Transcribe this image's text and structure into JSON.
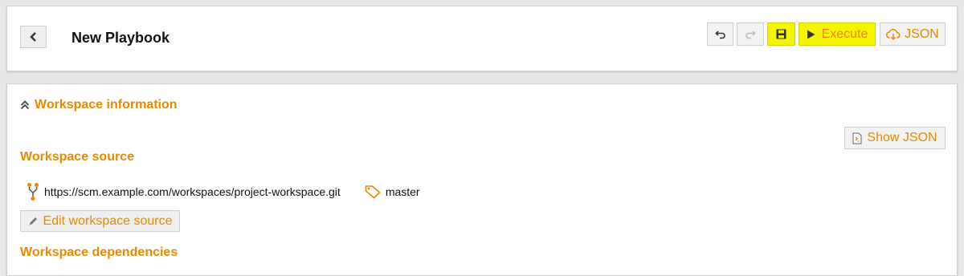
{
  "header": {
    "title": "New Playbook",
    "toolbar": {
      "execute_label": "Execute",
      "json_label": "JSON"
    }
  },
  "workspace_info": {
    "title": "Workspace information",
    "show_json_label": "Show JSON",
    "source_title": "Workspace source",
    "repo_url": "https://scm.example.com/workspaces/project-workspace.git",
    "branch": "master",
    "edit_source_label": "Edit workspace source",
    "dependencies_title": "Workspace dependencies"
  },
  "icons": {
    "back": "chevron-left-icon",
    "undo": "undo-icon",
    "redo": "redo-icon",
    "save": "floppy-disk-icon",
    "execute": "play-icon",
    "json": "cloud-download-icon",
    "collapse": "double-chevron-up-icon",
    "show_json": "file-code-icon",
    "repo": "git-fork-icon",
    "branch": "tag-icon",
    "edit": "pencil-icon"
  },
  "colors": {
    "accent": "#e68a00",
    "highlight": "#f5f500",
    "background": "#e6e6e6"
  }
}
